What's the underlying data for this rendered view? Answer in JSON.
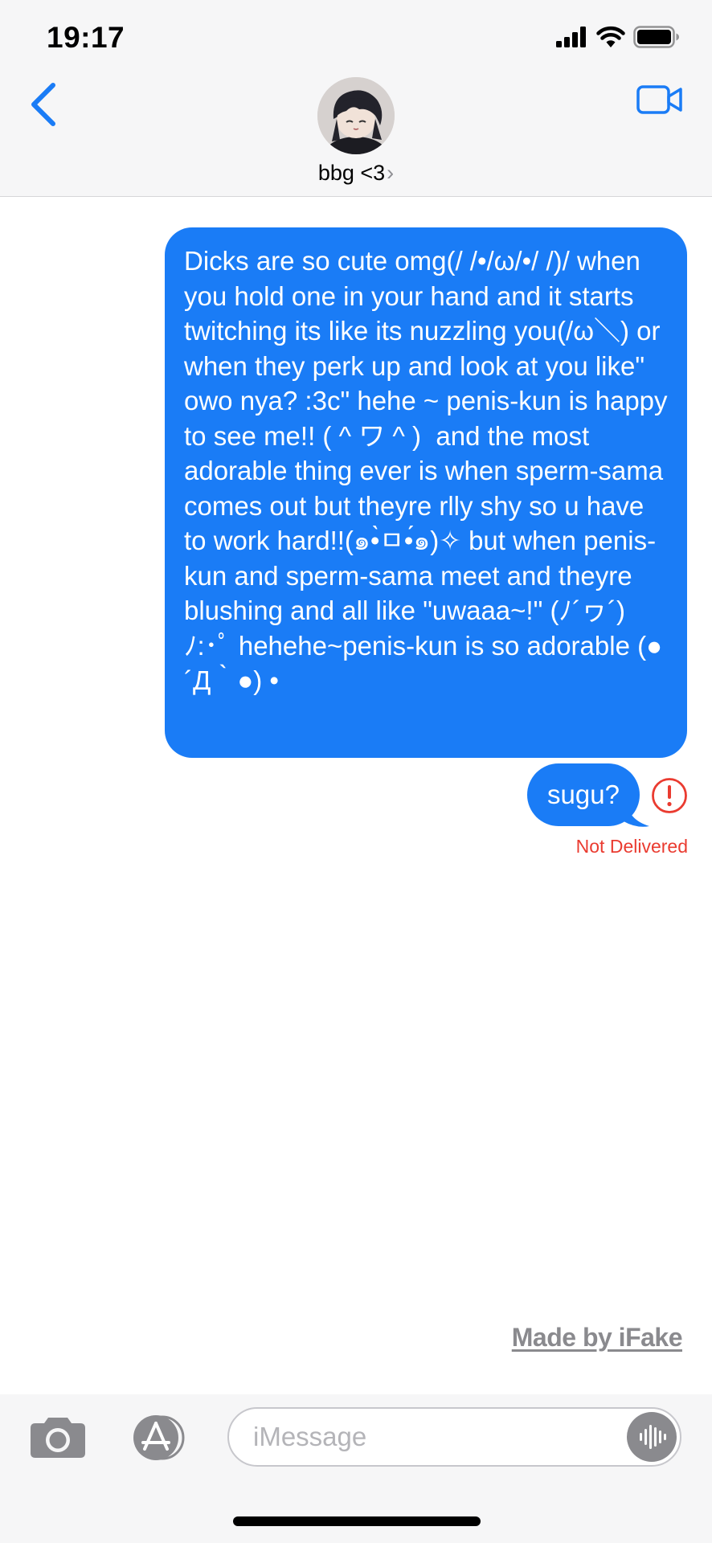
{
  "status_bar": {
    "time": "19:17"
  },
  "header": {
    "contact_name": "bbg <3",
    "chevron": "›",
    "back_icon": "chevron-left-icon",
    "video_icon": "video-camera-icon"
  },
  "messages": [
    {
      "direction": "outgoing",
      "text": "Dicks are so cute omg(/ /•/ω/•/ /)/ when you hold one in your hand and it starts twitching its like its nuzzling you(/ω＼) or when they perk up and look at you like\" owo nya? :3c\" hehe ~ penis-kun is happy to see me!! ( ^ ワ ^ )  and the most adorable thing ever is when sperm-sama comes out but theyre rlly shy so u have to work hard!!(๑•̀ㅁ•́๑)✧ but when penis-kun and sperm-sama meet and theyre blushing and all like \"uwaaa~!\" (ﾉ´ヮ´)ﾉ:･ﾟ hehehe~penis-kun is so adorable (●´Д｀●) •"
    },
    {
      "direction": "outgoing",
      "text": "sugu?",
      "status": "Not Delivered",
      "error_icon": "exclamation-circle-icon"
    }
  ],
  "watermark": "Made by iFake",
  "composer": {
    "placeholder": "iMessage",
    "camera_icon": "camera-icon",
    "appstore_icon": "app-store-icon",
    "audio_icon": "audio-waveform-icon"
  },
  "colors": {
    "bubble_blue": "#1a7cf6",
    "link_blue": "#1a7cf6",
    "error_red": "#ea3b30",
    "header_bg": "#f6f6f7"
  }
}
